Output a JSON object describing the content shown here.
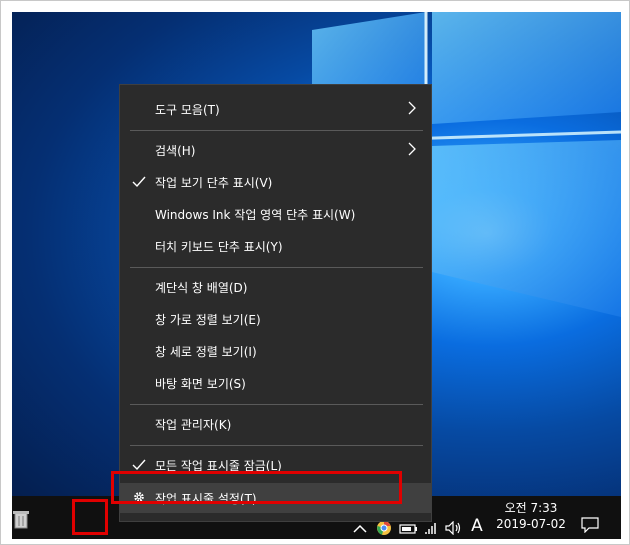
{
  "context_menu": {
    "items": [
      {
        "label": "도구 모음(T)",
        "has_submenu": true,
        "checked": false
      },
      {
        "label": "검색(H)",
        "has_submenu": true,
        "checked": false
      },
      {
        "label": "작업 보기 단추 표시(V)",
        "has_submenu": false,
        "checked": true
      },
      {
        "label": "Windows Ink 작업 영역 단추 표시(W)",
        "has_submenu": false,
        "checked": false
      },
      {
        "label": "터치 키보드 단추 표시(Y)",
        "has_submenu": false,
        "checked": false
      },
      {
        "label": "계단식 창 배열(D)",
        "has_submenu": false,
        "checked": false
      },
      {
        "label": "창 가로 정렬 보기(E)",
        "has_submenu": false,
        "checked": false
      },
      {
        "label": "창 세로 정렬 보기(I)",
        "has_submenu": false,
        "checked": false
      },
      {
        "label": "바탕 화면 보기(S)",
        "has_submenu": false,
        "checked": false
      },
      {
        "label": "작업 관리자(K)",
        "has_submenu": false,
        "checked": false
      },
      {
        "label": "모든 작업 표시줄 잠금(L)",
        "has_submenu": false,
        "checked": true
      },
      {
        "label": "작업 표시줄 설정(T)",
        "has_submenu": false,
        "checked": false,
        "icon": "gear-icon",
        "highlighted": true
      }
    ]
  },
  "taskbar": {
    "ime_indicator": "A",
    "time": "오전 7:33",
    "date": "2019-07-02",
    "icons": [
      "recycle-bin-icon",
      "chevron-up-icon",
      "chrome-icon",
      "battery-icon",
      "wifi-icon",
      "volume-icon",
      "notification-icon"
    ]
  },
  "colors": {
    "menu_background": "#2b2b2b",
    "highlight": "#404040",
    "annotation_red": "#e00000",
    "taskbar": "#101010"
  }
}
